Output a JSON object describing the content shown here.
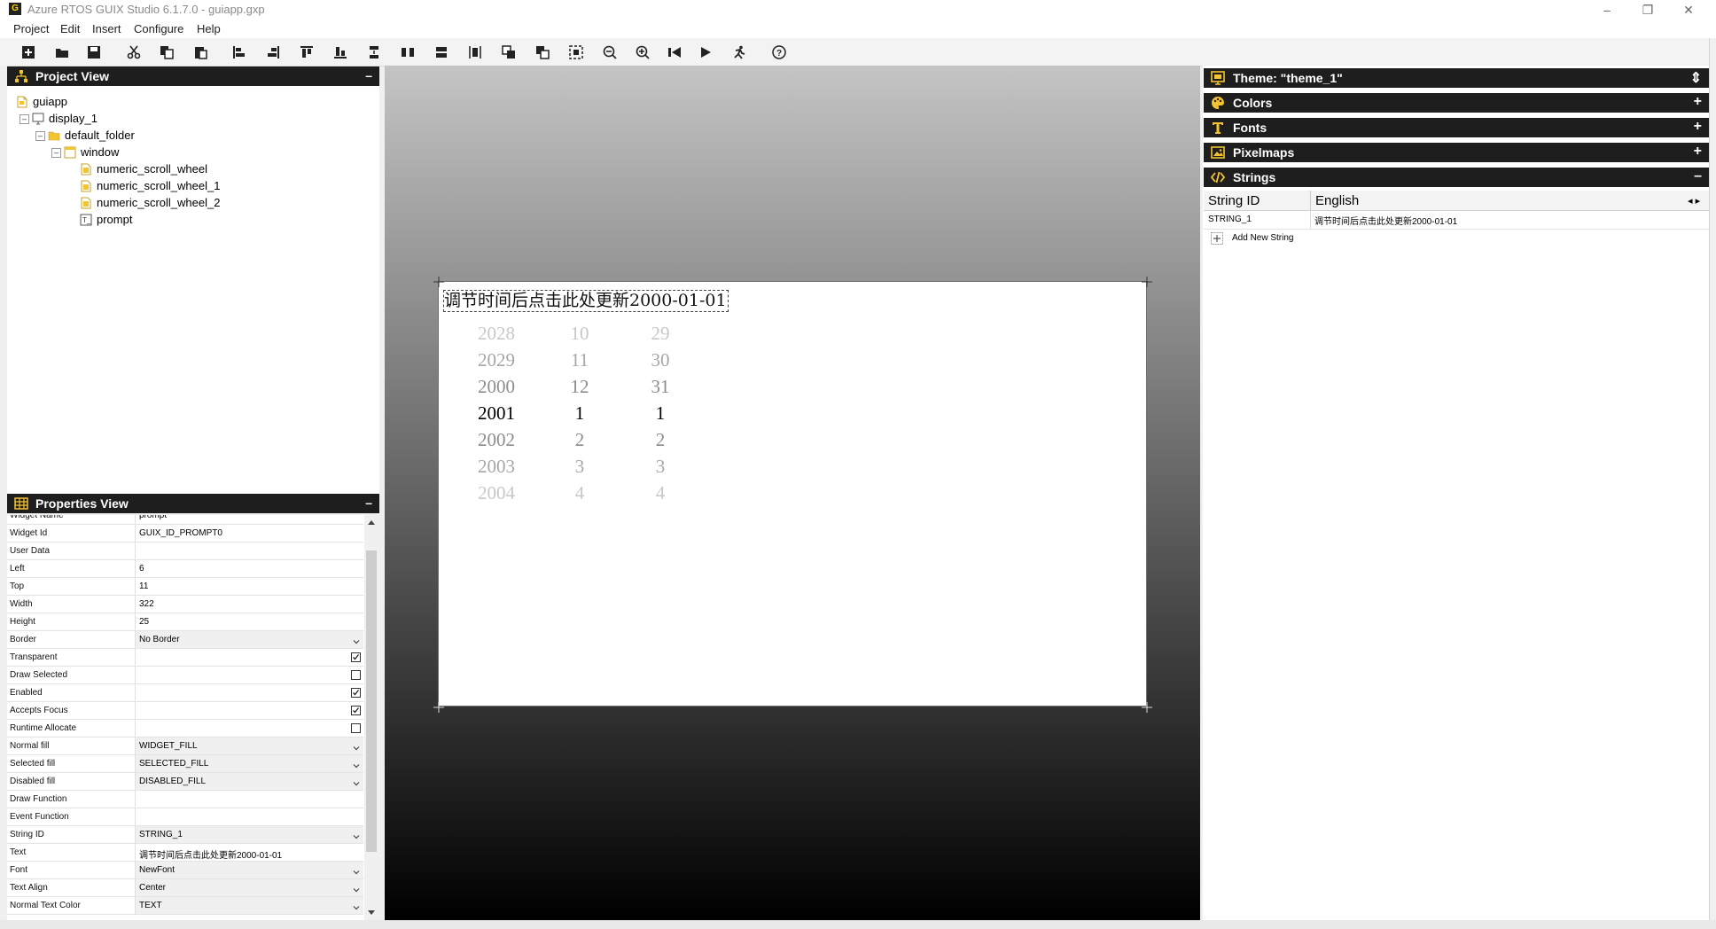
{
  "window": {
    "title": "Azure RTOS GUIX Studio 6.1.7.0 - guiapp.gxp",
    "app_icon_text": "G",
    "controls": [
      "–",
      "❐",
      "✕"
    ]
  },
  "menu": [
    "Project",
    "Edit",
    "Insert",
    "Configure",
    "Help"
  ],
  "toolbar": {
    "icons": [
      "new-project-icon",
      "open-icon",
      "save-icon",
      "cut-icon",
      "copy-icon",
      "paste-icon",
      "align-left-icon",
      "align-right-icon",
      "align-top-icon",
      "align-bottom-icon",
      "vertical-space-icon",
      "equal-width-icon",
      "horizontal-space-icon",
      "equal-height-icon",
      "move-to-front-icon",
      "move-to-back-icon",
      "size-to-content-icon",
      "zoom-out-icon",
      "zoom-in-icon",
      "macro-record-icon",
      "run-icon",
      "run-application-icon",
      "help-icon"
    ]
  },
  "project_view": {
    "title": "Project View",
    "collapse": "–",
    "tree": [
      {
        "label": "guiapp",
        "depth": 0,
        "icon": "project-icon"
      },
      {
        "label": "display_1",
        "depth": 1,
        "icon": "display-icon",
        "expander": "–"
      },
      {
        "label": "default_folder",
        "depth": 2,
        "icon": "folder-icon",
        "expander": "–"
      },
      {
        "label": "window",
        "depth": 3,
        "icon": "window-icon",
        "expander": "–"
      },
      {
        "label": "numeric_scroll_wheel",
        "depth": 4,
        "icon": "scroll-wheel-icon"
      },
      {
        "label": "numeric_scroll_wheel_1",
        "depth": 4,
        "icon": "scroll-wheel-icon"
      },
      {
        "label": "numeric_scroll_wheel_2",
        "depth": 4,
        "icon": "scroll-wheel-icon"
      },
      {
        "label": "prompt",
        "depth": 4,
        "icon": "prompt-icon"
      }
    ]
  },
  "properties_view": {
    "title": "Properties View",
    "collapse": "–",
    "rows": [
      {
        "name": "Widget Name",
        "value": "prompt",
        "kind": "text"
      },
      {
        "name": "Widget Id",
        "value": "GUIX_ID_PROMPT0",
        "kind": "text"
      },
      {
        "name": "User Data",
        "value": "",
        "kind": "text"
      },
      {
        "name": "Left",
        "value": "6",
        "kind": "text"
      },
      {
        "name": "Top",
        "value": "11",
        "kind": "text"
      },
      {
        "name": "Width",
        "value": "322",
        "kind": "text"
      },
      {
        "name": "Height",
        "value": "25",
        "kind": "text"
      },
      {
        "name": "Border",
        "value": "No Border",
        "kind": "dropdown"
      },
      {
        "name": "Transparent",
        "checked": true,
        "kind": "check"
      },
      {
        "name": "Draw Selected",
        "checked": false,
        "kind": "check"
      },
      {
        "name": "Enabled",
        "checked": true,
        "kind": "check"
      },
      {
        "name": "Accepts Focus",
        "checked": true,
        "kind": "check"
      },
      {
        "name": "Runtime Allocate",
        "checked": false,
        "kind": "check"
      },
      {
        "name": "Normal fill",
        "value": "WIDGET_FILL",
        "kind": "dropdown"
      },
      {
        "name": "Selected fill",
        "value": "SELECTED_FILL",
        "kind": "dropdown"
      },
      {
        "name": "Disabled fill",
        "value": "DISABLED_FILL",
        "kind": "dropdown"
      },
      {
        "name": "Draw Function",
        "value": "",
        "kind": "text"
      },
      {
        "name": "Event Function",
        "value": "",
        "kind": "text"
      },
      {
        "name": "String ID",
        "value": "STRING_1",
        "kind": "dropdown"
      },
      {
        "name": "Text",
        "value": "调节时间后点击此处更新2000-01-01",
        "kind": "text"
      },
      {
        "name": "Font",
        "value": "NewFont",
        "kind": "dropdown"
      },
      {
        "name": "Text Align",
        "value": "Center",
        "kind": "dropdown"
      },
      {
        "name": "Normal Text Color",
        "value": "TEXT",
        "kind": "dropdown"
      }
    ]
  },
  "canvas": {
    "prompt_text": "调节时间后点击此处更新2000-01-01",
    "wheels": [
      {
        "name": "year",
        "items": [
          "2028",
          "2029",
          "2000",
          "2001",
          "2002",
          "2003",
          "2004"
        ],
        "selected_index": 3
      },
      {
        "name": "month",
        "items": [
          "10",
          "11",
          "12",
          "1",
          "2",
          "3",
          "4"
        ],
        "selected_index": 3
      },
      {
        "name": "day",
        "items": [
          "29",
          "30",
          "31",
          "1",
          "2",
          "3",
          "4"
        ],
        "selected_index": 3
      }
    ]
  },
  "resources": {
    "theme": {
      "label": "Theme: \"theme_1\"",
      "control": "⇕"
    },
    "sections": [
      {
        "label": "Colors",
        "icon": "colors-icon",
        "control": "+"
      },
      {
        "label": "Fonts",
        "icon": "fonts-icon",
        "control": "+"
      },
      {
        "label": "Pixelmaps",
        "icon": "pixelmaps-icon",
        "control": "+"
      },
      {
        "label": "Strings",
        "icon": "strings-icon",
        "control": "–"
      }
    ],
    "strings_table": {
      "col_id": "String ID",
      "col_lang": "English",
      "nav": "◂ ▸",
      "rows": [
        {
          "id": "STRING_1",
          "text": "调节时间后点击此处更新2000-01-01"
        }
      ],
      "add_label": "Add New String"
    }
  },
  "colors": {
    "panel_head": "#1e1e1e",
    "accent_yellow": "#f4c430",
    "canvas_top": "#c4c4c4",
    "canvas_bottom": "#000000"
  }
}
